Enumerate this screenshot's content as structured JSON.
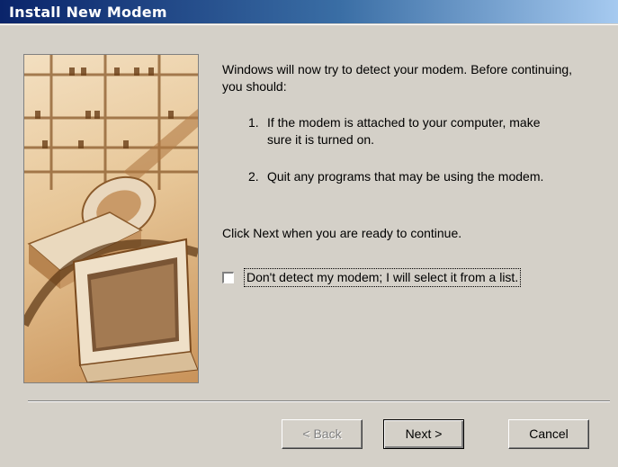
{
  "window": {
    "title": "Install New Modem"
  },
  "intro": "Windows will now try to detect your modem.  Before continuing, you should:",
  "steps": [
    {
      "num": "1.",
      "text": "If the modem is attached to your computer, make sure it is turned on."
    },
    {
      "num": "2.",
      "text": "Quit any programs that may be using the modem."
    }
  ],
  "next_prompt": "Click Next when you are ready to continue.",
  "checkbox": {
    "label": "Don't detect my modem; I will select it from a list.",
    "checked": false
  },
  "buttons": {
    "back": "< Back",
    "next": "Next >",
    "cancel": "Cancel"
  },
  "art": {
    "subject": "modem-and-monitor-illustration"
  },
  "colors": {
    "titlebar_start": "#0a246a",
    "titlebar_end": "#a6caf0",
    "dialog_bg": "#d4d0c8"
  }
}
